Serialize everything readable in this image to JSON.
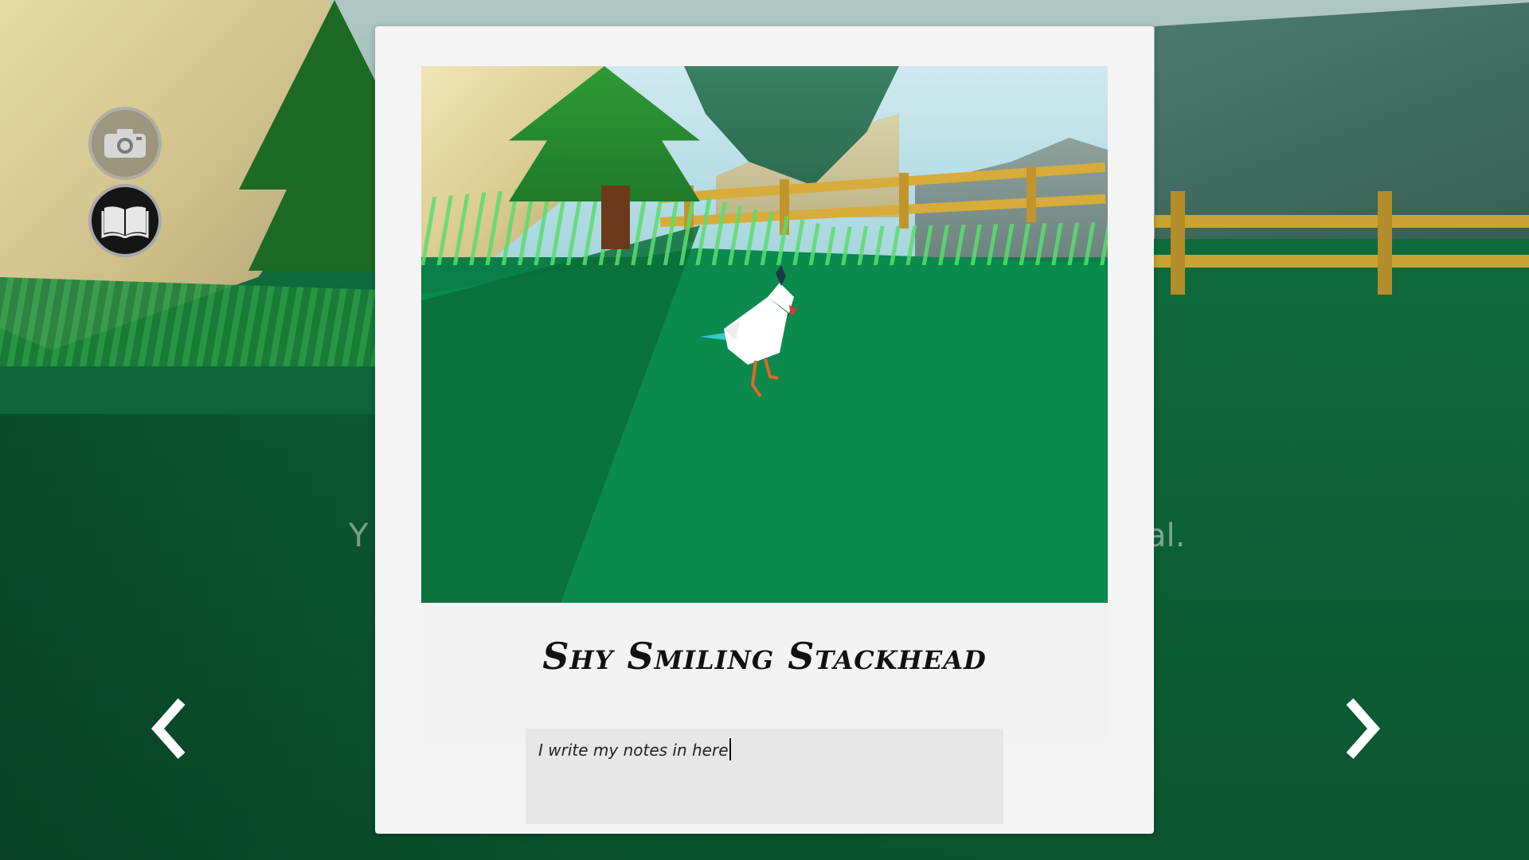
{
  "background": {
    "hint_left": "Y",
    "hint_right": "al."
  },
  "hud": {
    "camera_icon": "camera-icon",
    "journal_icon": "journal-book-icon"
  },
  "navigation": {
    "prev_icon": "chevron-left-icon",
    "next_icon": "chevron-right-icon"
  },
  "journal_entry": {
    "creature_name": "Shy Smiling Stackhead",
    "notes_value": "I write my notes in here"
  },
  "colors": {
    "polaroid_frame": "#f4f4f4",
    "notes_bg": "#e7e7e7",
    "grass": "#0a8a4c"
  }
}
